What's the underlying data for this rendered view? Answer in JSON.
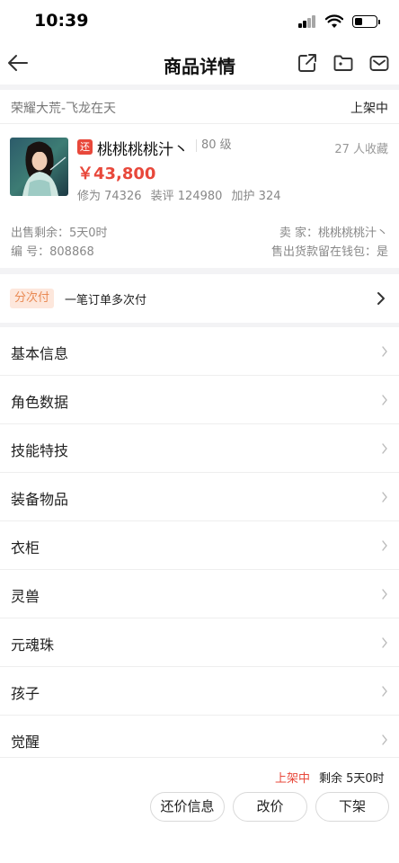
{
  "status_bar": {
    "time": "10:39"
  },
  "nav": {
    "title": "商品详情",
    "icons": [
      "back-arrow-icon",
      "share-icon",
      "folder-icon",
      "mail-icon"
    ]
  },
  "listing": {
    "game_server": "荣耀大荒-飞龙在天",
    "status": "上架中"
  },
  "product": {
    "tag": "还",
    "role_name": "桃桃桃桃汁丶",
    "level": "80 级",
    "favorites": "27 人收藏",
    "price": "￥43,800",
    "stats": [
      "修为 74326",
      "装评 124980",
      "加护 324"
    ],
    "sale_remaining": "出售剩余：5天0时",
    "seller": "卖 家：桃桃桃桃汁丶",
    "serial": "编 号：808868",
    "wallet": "售出货款留在钱包：是"
  },
  "installment": {
    "tag": "分次付",
    "text": "一笔订单多次付"
  },
  "menu": [
    "基本信息",
    "角色数据",
    "技能特技",
    "装备物品",
    "衣柜",
    "灵兽",
    "元魂珠",
    "孩子",
    "觉醒"
  ],
  "bottom": {
    "status": "上架中",
    "remaining": "剩余 5天0时",
    "buttons": [
      "还价信息",
      "改价",
      "下架"
    ]
  },
  "colors": {
    "accent": "#e8483b",
    "installment_tag_bg": "#fde7dc",
    "installment_tag_fg": "#e98a54"
  }
}
